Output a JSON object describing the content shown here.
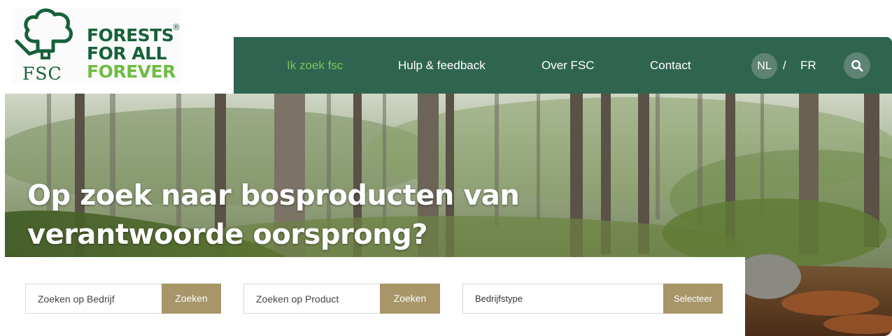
{
  "logo": {
    "mark": "FSC",
    "line1": "FORESTS",
    "line2": "FOR ALL",
    "line3": "FOREVER",
    "registered": "®"
  },
  "nav": {
    "items": [
      {
        "label": "Ik zoek fsc",
        "active": true
      },
      {
        "label": "Hulp & feedback",
        "active": false
      },
      {
        "label": "Over FSC",
        "active": false
      },
      {
        "label": "Contact",
        "active": false
      }
    ],
    "lang_active": "NL",
    "lang_separator": "/",
    "lang_other": "FR",
    "search_icon": "search-icon"
  },
  "hero": {
    "title_line1": "Op zoek naar bosproducten van",
    "title_line2": "verantwoorde oorsprong?"
  },
  "search": {
    "company": {
      "placeholder": "Zoeken op Bedrijf",
      "button": "Zoeken"
    },
    "product": {
      "placeholder": "Zoeken op Product",
      "button": "Zoeken"
    },
    "type": {
      "value": "Bedrijfstype",
      "button": "Selecteer"
    }
  },
  "colors": {
    "nav_bg": "#2f6550",
    "nav_active": "#7cc45a",
    "button_bg": "#a89568",
    "brand_dark_green": "#17613a",
    "brand_light_green": "#6fbd44"
  }
}
